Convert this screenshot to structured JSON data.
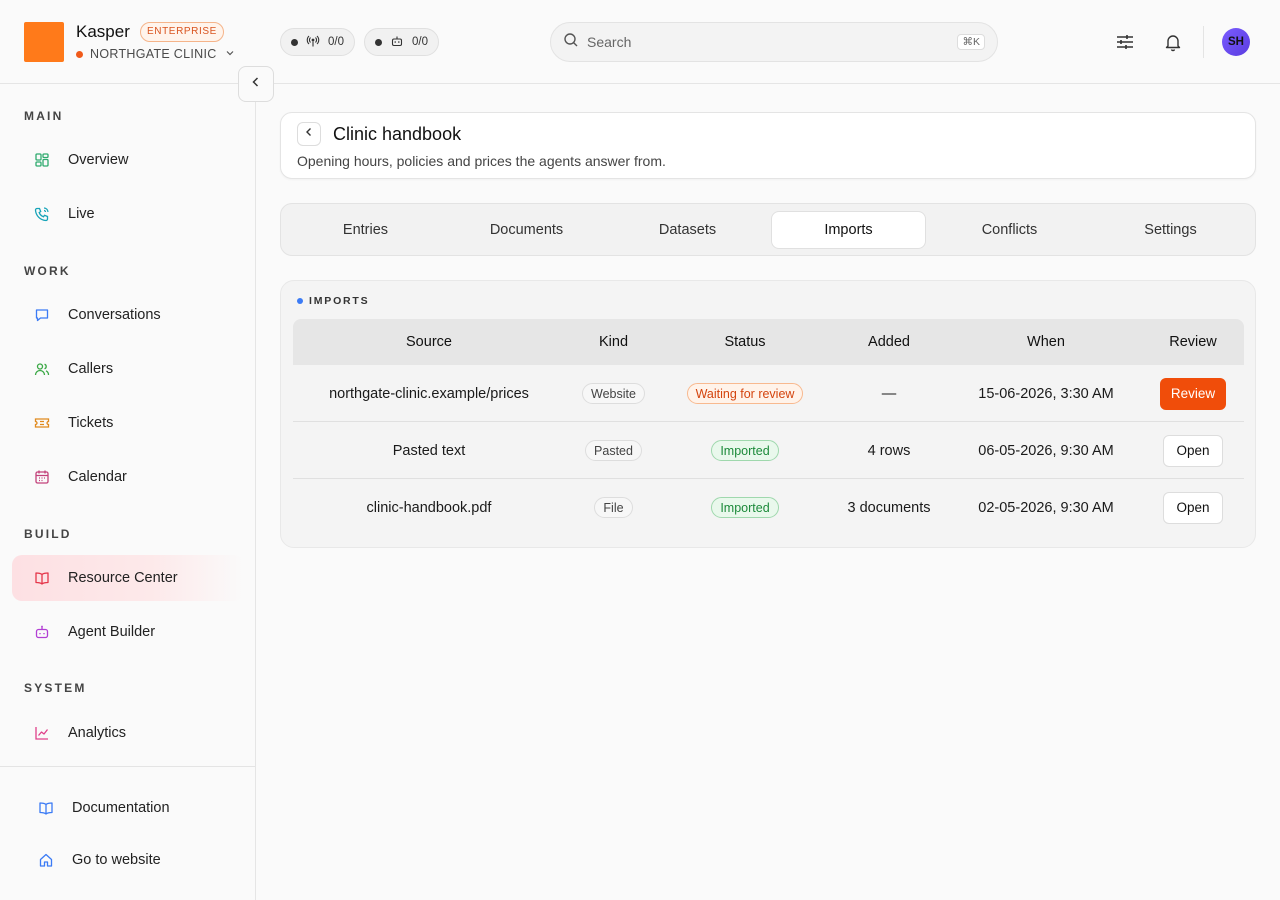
{
  "header": {
    "brand": "Kasper",
    "edition": "ENTERPRISE",
    "org": "NORTHGATE CLINIC",
    "live_calls_count": "0/0",
    "agents_count": "0/0",
    "search_placeholder": "Search",
    "search_shortcut": "⌘K",
    "user_initials": "SH"
  },
  "sidebar": {
    "sections": {
      "main": "MAIN",
      "work": "WORK",
      "build": "BUILD",
      "system": "SYSTEM"
    },
    "items": [
      {
        "label": "Overview",
        "icon": "grid-icon",
        "color": "#2eaa6e"
      },
      {
        "label": "Live",
        "icon": "phone-icon",
        "color": "#16a3b8"
      },
      {
        "label": "Conversations",
        "icon": "chat-icon",
        "color": "#3b7bf5"
      },
      {
        "label": "Callers",
        "icon": "users-icon",
        "color": "#3aa845"
      },
      {
        "label": "Tickets",
        "icon": "ticket-icon",
        "color": "#e08a1e"
      },
      {
        "label": "Calendar",
        "icon": "calendar-icon",
        "color": "#c2417a"
      },
      {
        "label": "Resource Center",
        "icon": "book-icon",
        "color": "#e5364a"
      },
      {
        "label": "Agent Builder",
        "icon": "bot-icon",
        "color": "#b23fd4"
      },
      {
        "label": "Analytics",
        "icon": "chart-icon",
        "color": "#e0408a"
      }
    ],
    "active": "Resource Center",
    "footer": [
      {
        "label": "Documentation",
        "icon": "book-open-icon",
        "color": "#3b7bf5"
      },
      {
        "label": "Go to website",
        "icon": "home-icon",
        "color": "#3b7bf5"
      }
    ]
  },
  "page": {
    "title": "Clinic handbook",
    "subtitle": "Opening hours, policies and prices the agents answer from."
  },
  "tabs": [
    "Entries",
    "Documents",
    "Datasets",
    "Imports",
    "Conflicts",
    "Settings"
  ],
  "active_tab": "Imports",
  "imports": {
    "label": "IMPORTS",
    "columns": [
      "Source",
      "Kind",
      "Status",
      "Added",
      "When",
      "Review"
    ],
    "rows": [
      {
        "source": "northgate-clinic.example/prices",
        "kind": "Website",
        "status": "Waiting for review",
        "added": "—",
        "when": "15-06-2026, 3:30 AM",
        "action": "Review"
      },
      {
        "source": "Pasted text",
        "kind": "Pasted",
        "status": "Imported",
        "added": "4 rows",
        "when": "06-05-2026, 9:30 AM",
        "action": "Open"
      },
      {
        "source": "clinic-handbook.pdf",
        "kind": "File",
        "status": "Imported",
        "added": "3 documents",
        "when": "02-05-2026, 9:30 AM",
        "action": "Open"
      }
    ]
  },
  "colors": {
    "accent": "#ff7a1a",
    "review_button": "#f04d0a",
    "status_waiting": "#d4440e",
    "status_imported": "#1c8a3a"
  }
}
